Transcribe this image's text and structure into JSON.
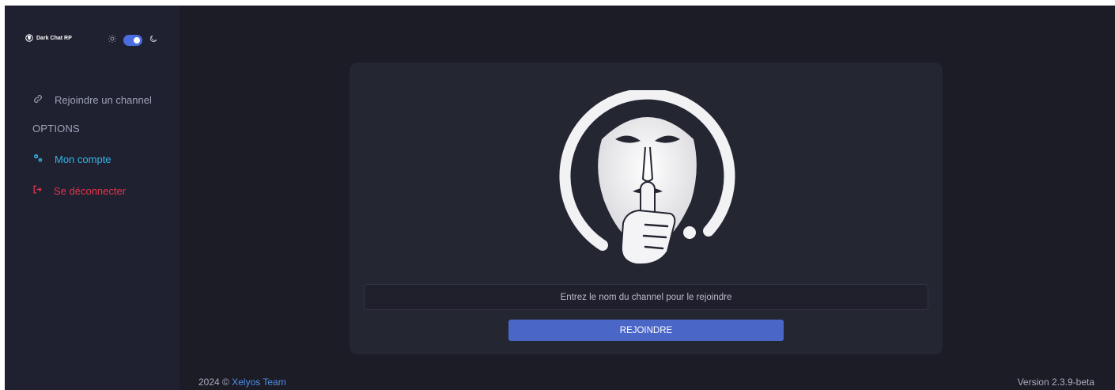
{
  "brand": {
    "name": "Dark Chat RP",
    "logo_icon": "hush-mask-icon"
  },
  "theme": {
    "light_icon": "sun-icon",
    "dark_icon": "moon-icon",
    "mode": "dark",
    "toggle_on": true
  },
  "sidebar": {
    "join_label": "Rejoindre un channel",
    "join_icon": "link-icon",
    "options_title": "OPTIONS",
    "account_label": "Mon compte",
    "account_icon": "gears-icon",
    "logout_label": "Se déconnecter",
    "logout_icon": "sign-out-icon"
  },
  "main": {
    "hero_icon": "hush-mask-icon",
    "input_placeholder": "Entrez le nom du channel pour le rejoindre",
    "join_button": "REJOINDRE"
  },
  "footer": {
    "prefix": "2024 © ",
    "team": "Xelyos Team",
    "version": "Version 2.3.9-beta"
  },
  "colors": {
    "background": "#1c1c27",
    "sidebar": "#1f2130",
    "card": "#242632",
    "accent": "#4a66c7",
    "account": "#32b4e8",
    "logout": "#e5344a"
  }
}
